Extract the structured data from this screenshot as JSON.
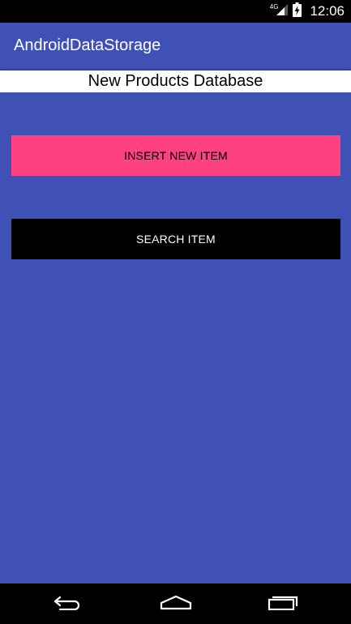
{
  "status_bar": {
    "network_label": "4G",
    "time": "12:06",
    "icons": [
      "signal-icon",
      "battery-charging-icon"
    ]
  },
  "app_bar": {
    "title": "AndroidDataStorage",
    "color": "#3F51B5"
  },
  "header": {
    "title": "New Products Database"
  },
  "buttons": {
    "insert_label": "INSERT NEW ITEM",
    "search_label": "SEARCH ITEM"
  },
  "nav_bar": {
    "icons": [
      "back-icon",
      "home-icon",
      "recents-icon"
    ]
  },
  "colors": {
    "primary": "#3F51B5",
    "accent": "#FF4081",
    "search_button": "#000000"
  }
}
